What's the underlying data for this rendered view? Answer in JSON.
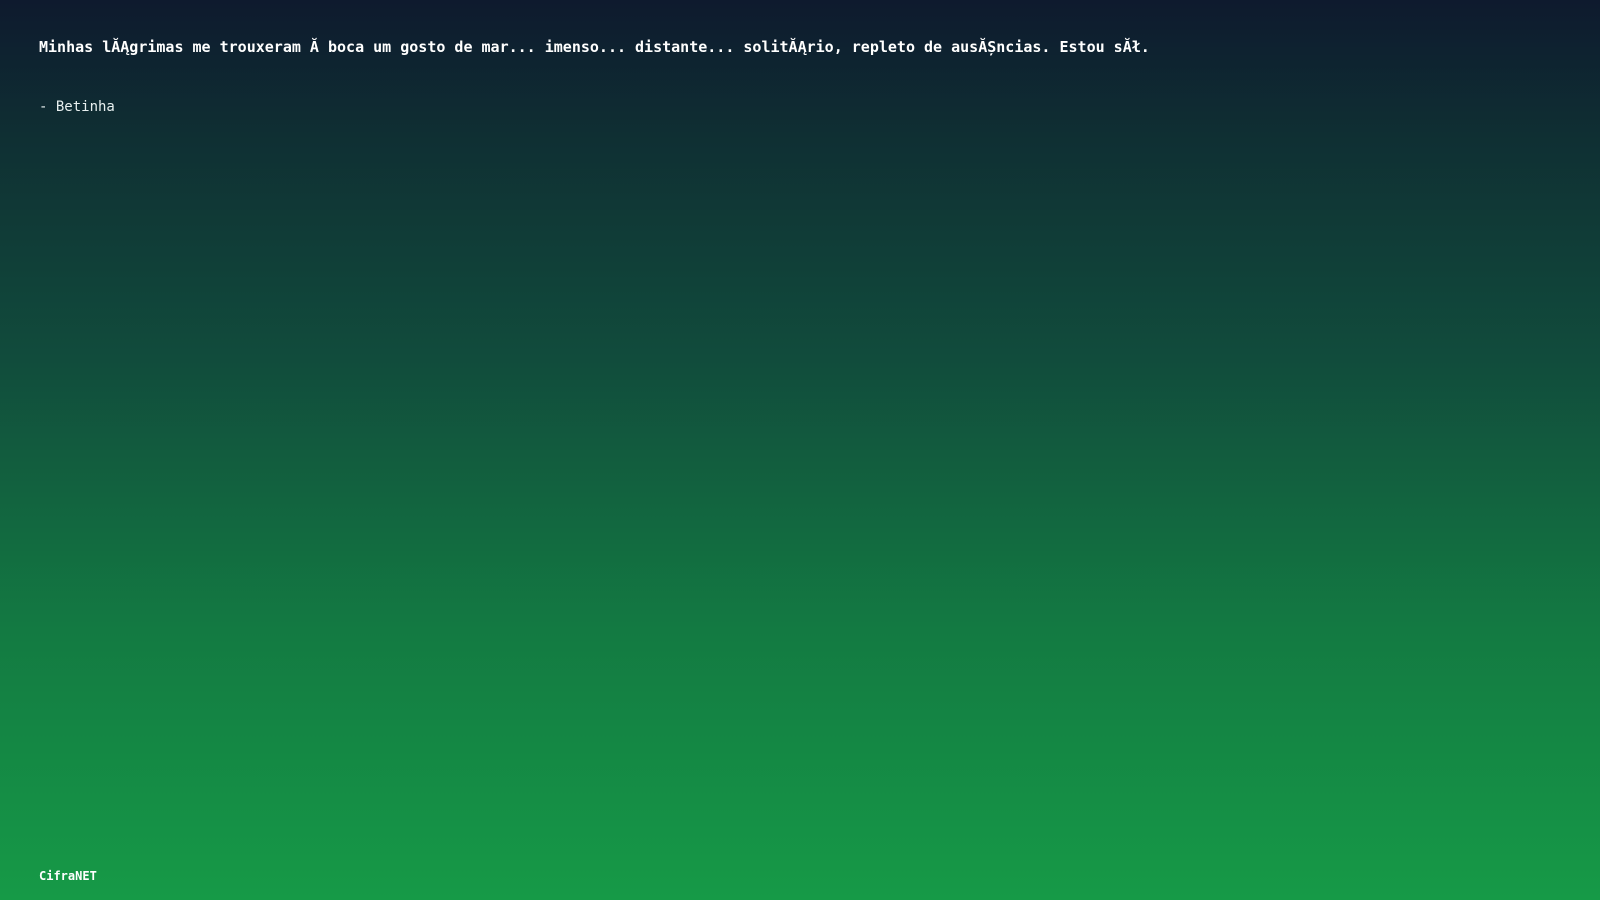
{
  "quote": {
    "text": "Minhas lĂĄgrimas me trouxeram Ă  boca um gosto de mar... imenso... distante... solitĂĄrio, repleto de ausĂȘncias. Estou sĂł.",
    "author": "- Betinha"
  },
  "footer": {
    "brand": "CifraNET"
  },
  "colors": {
    "gradient_top": "#0e1a2e",
    "gradient_bottom": "#169a47",
    "text": "#ffffff"
  }
}
